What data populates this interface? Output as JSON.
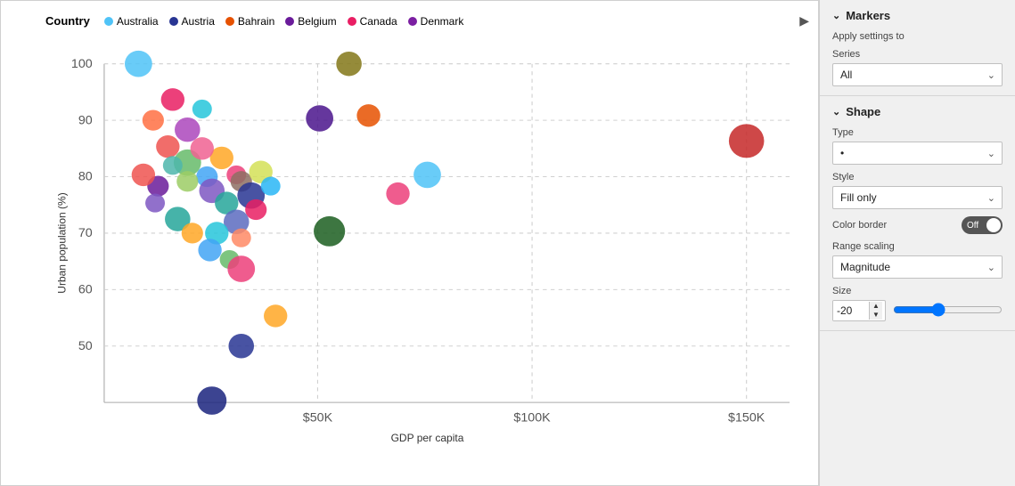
{
  "legend": {
    "label": "Country",
    "items": [
      {
        "name": "Australia",
        "color": "#4fc3f7"
      },
      {
        "name": "Austria",
        "color": "#283593"
      },
      {
        "name": "Bahrain",
        "color": "#e65100"
      },
      {
        "name": "Belgium",
        "color": "#6a1b9a"
      },
      {
        "name": "Canada",
        "color": "#e91e63"
      },
      {
        "name": "Denmark",
        "color": "#7b1fa2"
      }
    ]
  },
  "chart": {
    "y_axis_label": "Urban population (%)",
    "x_axis_label": "GDP per capita",
    "y_ticks": [
      "100",
      "90",
      "80",
      "70",
      "60",
      "50"
    ],
    "x_ticks": [
      "$50K",
      "$100K",
      "$150K"
    ]
  },
  "panel": {
    "sections": [
      {
        "id": "markers",
        "header": "Markers",
        "collapsed": false
      }
    ],
    "apply_settings_to": {
      "label": "Apply settings to",
      "series_label": "Series",
      "series_value": "All",
      "series_options": [
        "All"
      ]
    },
    "shape": {
      "section_label": "Shape",
      "type_label": "Type",
      "type_value": "•",
      "type_options": [
        "•"
      ],
      "style_label": "Style",
      "style_value": "Fill only",
      "style_options": [
        "Fill only"
      ],
      "color_border_label": "Color border",
      "color_border_toggle": "Off",
      "range_scaling_label": "Range scaling",
      "range_scaling_value": "Magnitude",
      "range_scaling_options": [
        "Magnitude"
      ],
      "size_label": "Size",
      "size_value": "-20"
    }
  }
}
